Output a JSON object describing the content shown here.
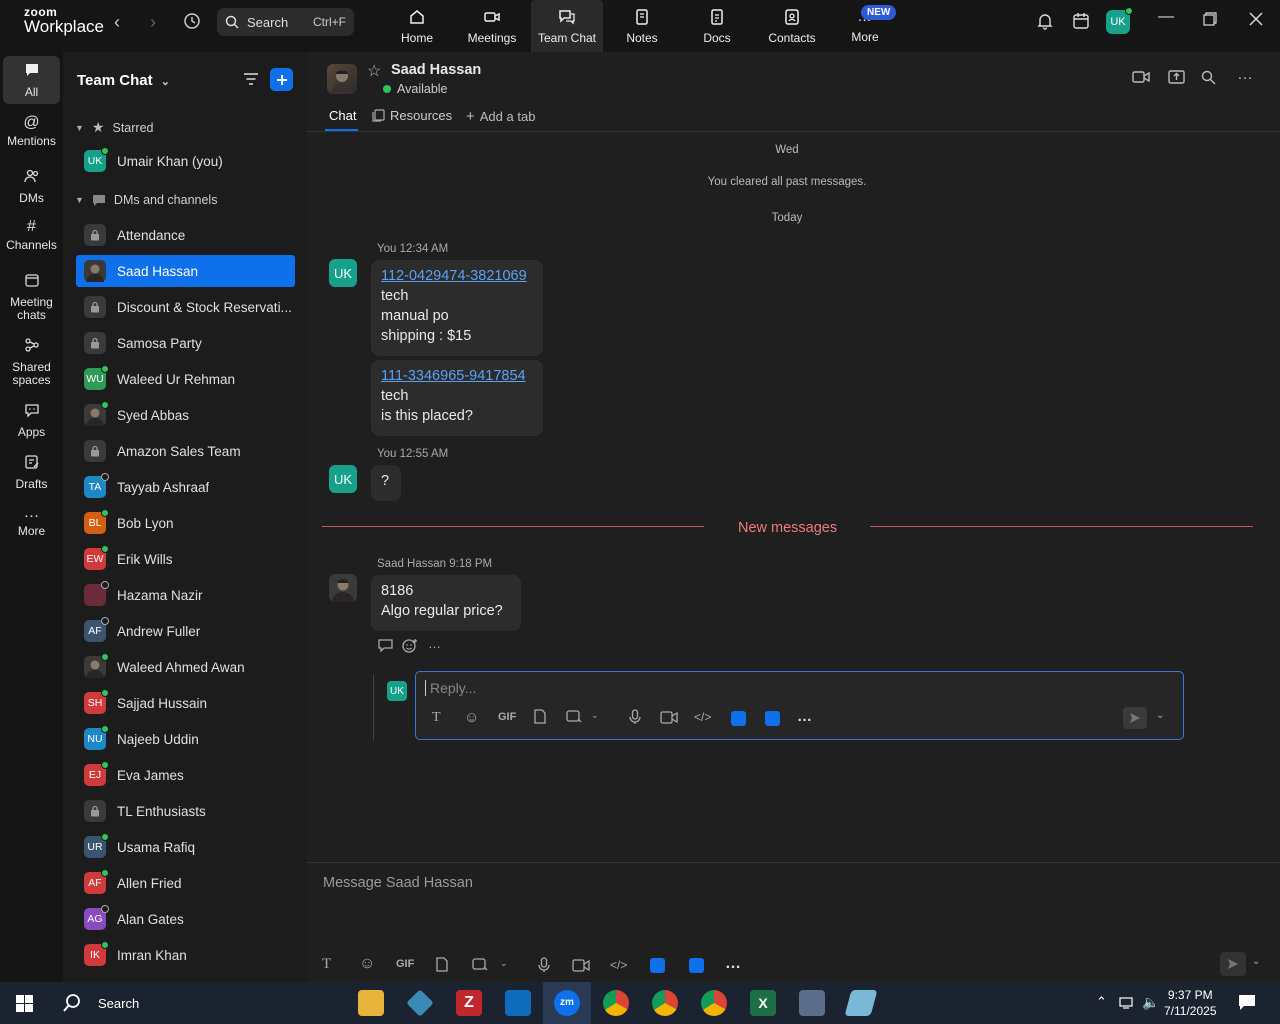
{
  "app": {
    "logo_top": "zoom",
    "logo_bottom": "Workplace"
  },
  "search": {
    "label": "Search",
    "shortcut": "Ctrl+F"
  },
  "topnav": [
    {
      "label": "Home",
      "icon": "home-icon"
    },
    {
      "label": "Meetings",
      "icon": "video-icon"
    },
    {
      "label": "Team Chat",
      "icon": "chat-icon",
      "active": true
    },
    {
      "label": "Notes",
      "icon": "notes-icon"
    },
    {
      "label": "Docs",
      "icon": "docs-icon"
    },
    {
      "label": "Contacts",
      "icon": "contacts-icon"
    },
    {
      "label": "More",
      "icon": "more-icon",
      "badge": "NEW"
    }
  ],
  "user_avatar": "UK",
  "rail": [
    {
      "label": "All",
      "icon": "chat-bubble-icon",
      "active": true
    },
    {
      "label": "Mentions",
      "icon": "at-icon"
    },
    {
      "label": "DMs",
      "icon": "people-icon"
    },
    {
      "label": "Channels",
      "icon": "hash-icon"
    },
    {
      "label": "Meeting chats",
      "icon": "calendar-icon"
    },
    {
      "label": "Shared spaces",
      "icon": "share-icon"
    },
    {
      "label": "Apps",
      "icon": "apps-icon"
    },
    {
      "label": "Drafts",
      "icon": "drafts-icon"
    },
    {
      "label": "More",
      "icon": "ellipsis-icon"
    }
  ],
  "sidebar": {
    "title": "Team Chat",
    "starred_label": "Starred",
    "starred": [
      {
        "initials": "UK",
        "name": "Umair Khan (you)",
        "color": "#18a18a",
        "status": "online"
      }
    ],
    "dms_label": "DMs and channels",
    "items": [
      {
        "initials": "",
        "name": "Attendance",
        "type": "lock"
      },
      {
        "initials": "",
        "name": "Saad Hassan",
        "type": "photo",
        "selected": true
      },
      {
        "initials": "",
        "name": "Discount & Stock Reservati...",
        "type": "lock"
      },
      {
        "initials": "",
        "name": "Samosa Party",
        "type": "lock"
      },
      {
        "initials": "WU",
        "name": "Waleed Ur Rehman",
        "color": "#2e9b57",
        "status": "online"
      },
      {
        "initials": "",
        "name": "Syed Abbas",
        "type": "photo",
        "status": "online"
      },
      {
        "initials": "",
        "name": "Amazon Sales Team",
        "type": "lock"
      },
      {
        "initials": "TA",
        "name": "Tayyab Ashraaf",
        "color": "#1e88c7",
        "status": "offline"
      },
      {
        "initials": "BL",
        "name": "Bob Lyon",
        "color": "#d35f13",
        "status": "online"
      },
      {
        "initials": "EW",
        "name": "Erik Wills",
        "color": "#d13a3a",
        "status": "online"
      },
      {
        "initials": "",
        "name": "Hazama Nazir",
        "color": "#6b2b3a",
        "status": "offline"
      },
      {
        "initials": "AF",
        "name": "Andrew Fuller",
        "color": "#3b5570",
        "status": "offline"
      },
      {
        "initials": "",
        "name": "Waleed Ahmed Awan",
        "type": "photo",
        "status": "online"
      },
      {
        "initials": "SH",
        "name": "Sajjad Hussain",
        "color": "#d13a3a",
        "status": "online"
      },
      {
        "initials": "NU",
        "name": "Najeeb Uddin",
        "color": "#1e88c7",
        "status": "online"
      },
      {
        "initials": "EJ",
        "name": "Eva James",
        "color": "#d13a3a",
        "status": "online"
      },
      {
        "initials": "",
        "name": "TL Enthusiasts",
        "type": "lock"
      },
      {
        "initials": "UR",
        "name": "Usama Rafiq",
        "color": "#3b5570",
        "status": "online"
      },
      {
        "initials": "AF",
        "name": "Allen Fried",
        "color": "#d13a3a",
        "status": "online"
      },
      {
        "initials": "AG",
        "name": "Alan Gates",
        "color": "#8a4bc0",
        "status": "offline"
      },
      {
        "initials": "IK",
        "name": "Imran Khan",
        "color": "#d13a3a",
        "status": "online"
      }
    ]
  },
  "chat": {
    "name": "Saad Hassan",
    "status": "Available",
    "tabs": [
      "Chat",
      "Resources",
      "Add a tab"
    ],
    "day1": "Wed",
    "cleared": "You cleared all past messages.",
    "day2": "Today",
    "msg1": {
      "header": "You 12:34 AM",
      "link": "112-0429474-3821069",
      "lines": [
        "tech",
        "manual po",
        "shipping : $15"
      ]
    },
    "msg2": {
      "link": "111-3346965-9417854",
      "lines": [
        "tech",
        "is this placed?"
      ]
    },
    "msg3": {
      "header": "You 12:55 AM",
      "text": "?"
    },
    "new_messages": "New messages",
    "msg4": {
      "header": "Saad Hassan 9:18 PM",
      "lines": [
        "8186",
        "Algo regular price?"
      ]
    },
    "reply_placeholder": "Reply...",
    "composer_placeholder": "Message Saad Hassan",
    "gif": "GIF"
  },
  "taskbar": {
    "search": "Search",
    "time": "9:37 PM",
    "date": "7/11/2025"
  },
  "colors": {
    "accent": "#0e71eb",
    "online": "#2ec55a",
    "new_messages": "#ef7a7a"
  }
}
